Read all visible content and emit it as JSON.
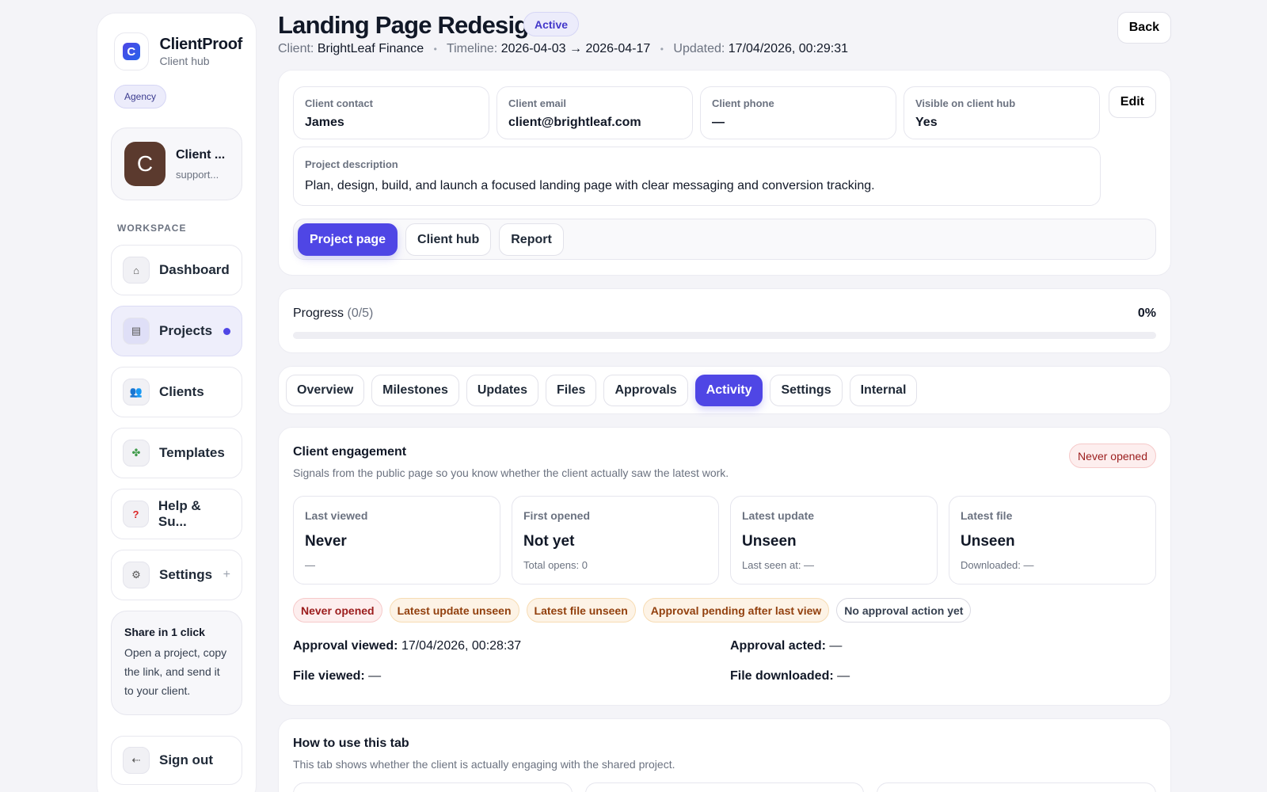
{
  "brand": {
    "name": "ClientProof",
    "sub": "Client hub",
    "logo_letter": "C",
    "badge": "Agency"
  },
  "profile": {
    "initial": "C",
    "name": "Client ...",
    "email": "support..."
  },
  "sidebar": {
    "section": "WORKSPACE",
    "items": [
      {
        "label": "Dashboard",
        "icon": "home-icon",
        "glyph": "⌂"
      },
      {
        "label": "Projects",
        "icon": "folder-icon",
        "glyph": "▤"
      },
      {
        "label": "Clients",
        "icon": "people-icon",
        "glyph": "👥"
      },
      {
        "label": "Templates",
        "icon": "puzzle-icon",
        "glyph": "✤"
      },
      {
        "label": "Help & Su...",
        "icon": "help-icon",
        "glyph": "?"
      },
      {
        "label": "Settings",
        "icon": "gear-icon",
        "glyph": "⚙"
      }
    ],
    "settings_plus": "+",
    "share": {
      "title": "Share in 1 click",
      "text": "Open a project, copy the link, and send it to your client."
    },
    "signout": {
      "label": "Sign out",
      "glyph": "⇠"
    }
  },
  "header": {
    "title": "Landing Page Redesign",
    "status": "Active",
    "client_label": "Client:",
    "client_value": "BrightLeaf Finance",
    "timeline_label": "Timeline:",
    "timeline_value": "2026-04-03 → 2026-04-17",
    "updated_label": "Updated:",
    "updated_value": "17/04/2026, 00:29:31",
    "sep": "•",
    "back": "Back"
  },
  "info": {
    "fields": [
      {
        "label": "Client contact",
        "value": "James"
      },
      {
        "label": "Client email",
        "value": "client@brightleaf.com"
      },
      {
        "label": "Client phone",
        "value": "—"
      },
      {
        "label": "Visible on client hub",
        "value": "Yes"
      }
    ],
    "edit": "Edit",
    "description_label": "Project description",
    "description_value": "Plan, design, build, and launch a focused landing page with clear messaging and conversion tracking.",
    "views": [
      "Project page",
      "Client hub",
      "Report"
    ]
  },
  "progress": {
    "label": "Progress",
    "count": "(0/5)",
    "percent_text": "0%",
    "fraction": 0
  },
  "tabs": [
    "Overview",
    "Milestones",
    "Updates",
    "Files",
    "Approvals",
    "Activity",
    "Settings",
    "Internal"
  ],
  "engagement": {
    "title": "Client engagement",
    "subtitle": "Signals from the public page so you know whether the client actually saw the latest work.",
    "badge": "Never opened",
    "stats": [
      {
        "label": "Last viewed",
        "value": "Never",
        "sub": "—"
      },
      {
        "label": "First opened",
        "value": "Not yet",
        "sub": "Total opens: 0"
      },
      {
        "label": "Latest update",
        "value": "Unseen",
        "sub": "Last seen at: —"
      },
      {
        "label": "Latest file",
        "value": "Unseen",
        "sub": "Downloaded: —"
      }
    ],
    "chips": [
      "Never opened",
      "Latest update unseen",
      "Latest file unseen",
      "Approval pending after last view",
      "No approval action yet"
    ],
    "approval_viewed_label": "Approval viewed:",
    "approval_viewed_value": "17/04/2026, 00:28:37",
    "approval_acted_label": "Approval acted:",
    "approval_acted_value": "—",
    "file_viewed_label": "File viewed:",
    "file_viewed_value": "—",
    "file_downloaded_label": "File downloaded:",
    "file_downloaded_value": "—"
  },
  "howto": {
    "title": "How to use this tab",
    "subtitle": "This tab shows whether the client is actually engaging with the shared project."
  },
  "colors": {
    "accent": "#4f46e5",
    "danger": "#9b1c1c",
    "warning": "#92400e"
  }
}
